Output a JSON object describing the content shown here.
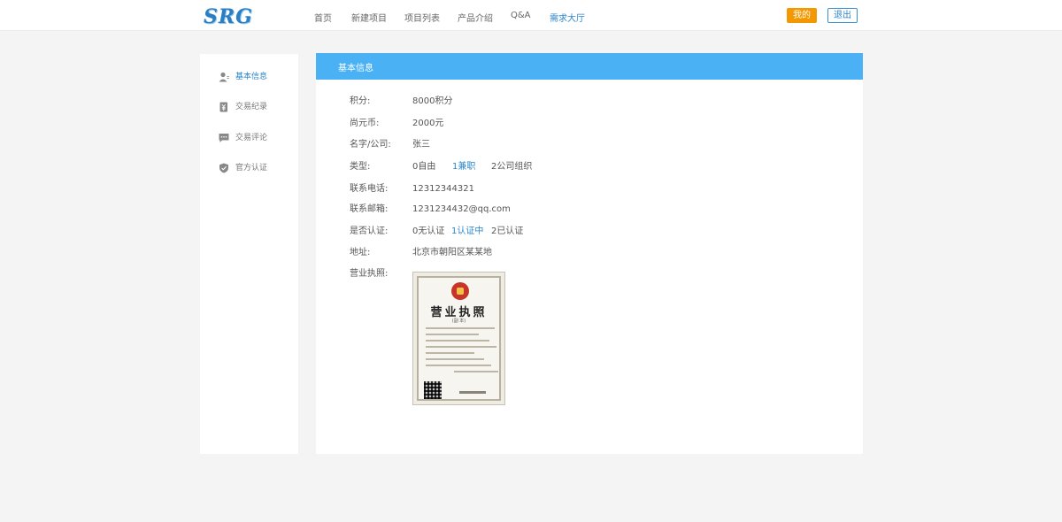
{
  "header": {
    "logo": "SRG",
    "nav": [
      "首页",
      "新建项目",
      "项目列表",
      "产品介绍",
      "Q&A",
      "需求大厅"
    ],
    "active_nav": "需求大厅",
    "mine_label": "我的",
    "logout_label": "退出"
  },
  "sidebar": {
    "items": [
      {
        "label": "基本信息",
        "icon": "user-icon",
        "active": true
      },
      {
        "label": "交易纪录",
        "icon": "receipt-icon",
        "active": false
      },
      {
        "label": "交易评论",
        "icon": "comment-icon",
        "active": false
      },
      {
        "label": "官方认证",
        "icon": "shield-icon",
        "active": false
      }
    ]
  },
  "main": {
    "title": "基本信息",
    "fields": {
      "points": {
        "label": "积分:",
        "value": "8000积分"
      },
      "coins": {
        "label": "尚元币:",
        "value": "2000元"
      },
      "name": {
        "label": "名字/公司:",
        "value": "张三"
      },
      "type": {
        "label": "类型:",
        "options": [
          "0自由",
          "1兼职",
          "2公司组织"
        ],
        "selected": "1兼职"
      },
      "phone": {
        "label": "联系电话:",
        "value": "12312344321"
      },
      "email": {
        "label": "联系邮箱:",
        "value": "1231234432@qq.com"
      },
      "verified": {
        "label": "是否认证:",
        "options": [
          "0无认证",
          "1认证中",
          "2已认证"
        ],
        "selected": "1认证中"
      },
      "address": {
        "label": "地址:",
        "value": "北京市朝阳区某某地"
      },
      "license": {
        "label": "营业执照:",
        "image_title": "营业执照",
        "image_subtitle": "(副 本)"
      }
    }
  },
  "colors": {
    "accent": "#4ab2f4",
    "link": "#2a86c9",
    "mine_button": "#f39800",
    "background": "#f4f4f5"
  }
}
